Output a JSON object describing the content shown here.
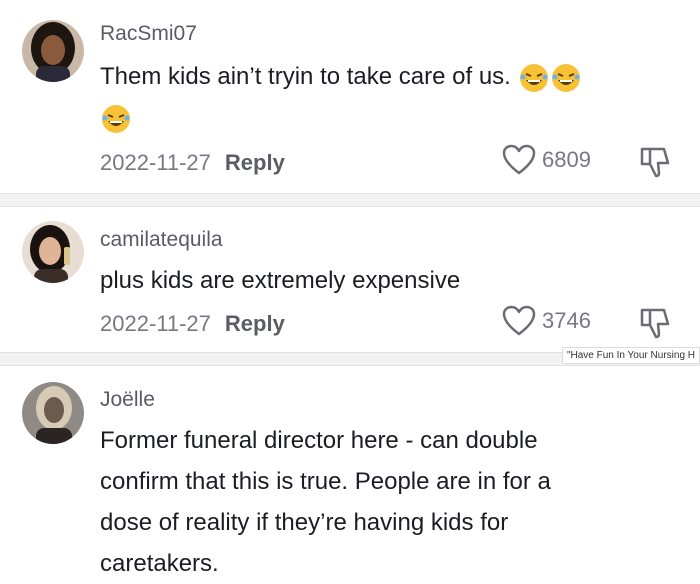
{
  "comments": [
    {
      "username": "RacSmi07",
      "text": "Them kids ain’t tryin to take care of us.",
      "date": "2022-11-27",
      "reply_label": "Reply",
      "likes": "6809",
      "avatar_icon": "avatar-photo-icon"
    },
    {
      "username": "camilatequila",
      "text": "plus kids are extremely expensive",
      "date": "2022-11-27",
      "reply_label": "Reply",
      "likes": "3746",
      "avatar_icon": "avatar-photo-icon"
    },
    {
      "username": "Joëlle",
      "text_lines": [
        "Former funeral director here - can double",
        "confirm that this is true. People are in for a",
        "dose of reality if they’re having kids for",
        "caretakers."
      ],
      "avatar_icon": "avatar-photo-icon"
    }
  ],
  "watermark": "\"Have Fun In Your Nursing H",
  "colors": {
    "text": "#161823",
    "muted": "#777880",
    "separator": "#f2f2f2",
    "emoji": "#f7c236"
  }
}
